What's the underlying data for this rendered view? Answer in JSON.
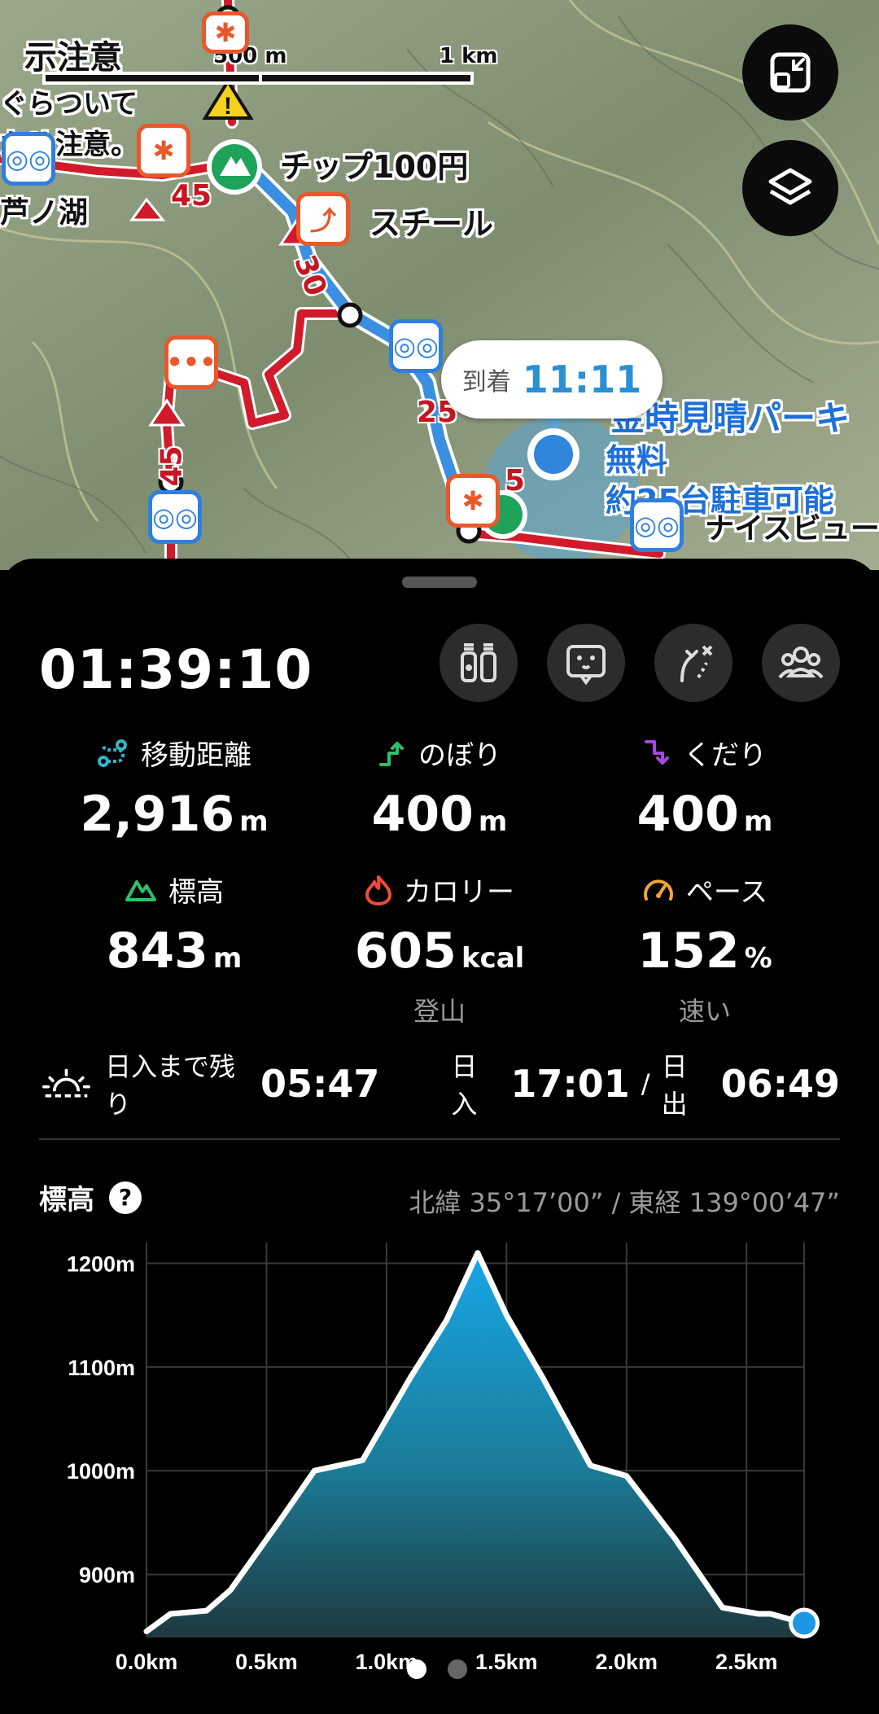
{
  "map": {
    "scale": {
      "left_label": "500 m",
      "right_label": "1 km"
    },
    "labels": {
      "notice1": "示注意",
      "notice2": "ぐらついて",
      "notice3": "ため注意。",
      "lake": "芦ノ湖",
      "tip": "チップ100円",
      "steel": "スチール",
      "parking_name": "金時見晴パーキ",
      "parking_fee": "無料",
      "parking_capacity": "約25台駐車可能",
      "nice_view": "ナイスビュー"
    },
    "route_numbers": [
      "45",
      "30",
      "25",
      "5",
      "45"
    ],
    "arrival": {
      "label": "到着",
      "time": "11:11"
    },
    "buttons": {
      "collapse_icon": "collapse-icon",
      "layers_icon": "layers-icon"
    }
  },
  "stats": {
    "elapsed": "01:39:10",
    "distance": {
      "label": "移動距離",
      "value": "2,916",
      "unit": "m"
    },
    "ascent": {
      "label": "のぼり",
      "value": "400",
      "unit": "m"
    },
    "descent": {
      "label": "くだり",
      "value": "400",
      "unit": "m"
    },
    "altitude": {
      "label": "標高",
      "value": "843",
      "unit": "m"
    },
    "calories": {
      "label": "カロリー",
      "value": "605",
      "unit": "kcal",
      "sub": "登山"
    },
    "pace": {
      "label": "ペース",
      "value": "152",
      "unit": "%",
      "sub": "速い"
    }
  },
  "sun": {
    "until_label": "日入まで残り",
    "until_value": "05:47",
    "sunset_label": "日入",
    "sunset_value": "17:01",
    "sep": "/",
    "sunrise_label": "日出",
    "sunrise_value": "06:49"
  },
  "elevation": {
    "title": "標高",
    "help": "?",
    "coords": "北緯 35°17’00” / 東経 139°00’47”"
  },
  "colors": {
    "accent": "#2c8fd4",
    "route_red": "#d11a2a",
    "route_blue": "#3b8fe0"
  },
  "chart_data": {
    "type": "area",
    "x": [
      0.0,
      0.1,
      0.25,
      0.35,
      0.55,
      0.7,
      0.9,
      1.1,
      1.25,
      1.38,
      1.5,
      1.65,
      1.85,
      2.0,
      2.2,
      2.4,
      2.55,
      2.6,
      2.74
    ],
    "values": [
      845,
      862,
      865,
      885,
      950,
      1000,
      1010,
      1090,
      1145,
      1210,
      1150,
      1090,
      1005,
      995,
      935,
      868,
      862,
      862,
      853
    ],
    "xlabel": "",
    "ylabel": "",
    "xticks": [
      "0.0km",
      "0.5km",
      "1.0km",
      "1.5km",
      "2.0km",
      "2.5km"
    ],
    "yticks": [
      "900m",
      "1000m",
      "1100m",
      "1200m"
    ],
    "xlim": [
      0,
      2.74
    ],
    "ylim": [
      840,
      1220
    ],
    "grid": true
  },
  "pager": {
    "count": 2,
    "active": 0
  }
}
